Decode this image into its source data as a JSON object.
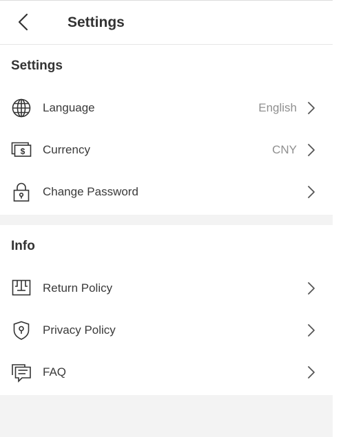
{
  "header": {
    "title": "Settings",
    "back_icon": "chevron-left-icon"
  },
  "settings_section": {
    "title": "Settings",
    "items": [
      {
        "label": "Language",
        "value": "English",
        "icon": "globe-icon"
      },
      {
        "label": "Currency",
        "value": "CNY",
        "icon": "banknote-icon"
      },
      {
        "label": "Change Password",
        "value": "",
        "icon": "lock-icon"
      }
    ]
  },
  "info_section": {
    "title": "Info",
    "items": [
      {
        "label": "Return Policy",
        "icon": "return-box-icon"
      },
      {
        "label": "Privacy Policy",
        "icon": "shield-lock-icon"
      },
      {
        "label": "FAQ",
        "icon": "chat-bubbles-icon"
      }
    ]
  },
  "colors": {
    "background": "#f3f3f3",
    "card": "#ffffff",
    "text": "#333333",
    "value_text": "#8f8f8f"
  }
}
